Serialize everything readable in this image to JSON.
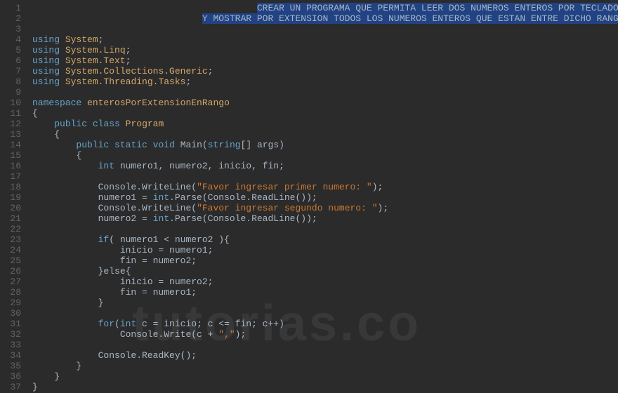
{
  "watermark": "tutorias.co",
  "comment": {
    "line1": "CREAR UN PROGRAMA QUE PERMITA LEER DOS NUMEROS ENTEROS POR TECLADO",
    "line2": "Y MOSTRAR POR EXTENSION TODOS LOS NUMEROS ENTEROS QUE ESTAN ENTRE DICHO RANGO"
  },
  "code": {
    "using": "using",
    "ns1": "System",
    "ns2": "System.Linq",
    "ns3": "System.Text",
    "ns4": "System.Collections.Generic",
    "ns5": "System.Threading.Tasks",
    "namespace_kw": "namespace",
    "namespace_name": "enterosPorExtensionEnRango",
    "public": "public",
    "class_kw": "class",
    "class_name": "Program",
    "static": "static",
    "void": "void",
    "main": "Main",
    "string_type": "string",
    "args": "[] args)",
    "int_kw": "int",
    "vars": " numero1, numero2, inicio, fin;",
    "console": "Console",
    "writeline": ".WriteLine(",
    "str1": "\"Favor ingresar primer numero: \"",
    "str2": "\"Favor ingresar segundo numero: \"",
    "n1_assign": "numero1 = ",
    "n2_assign": "numero2 = ",
    "parse": ".Parse(Console.ReadLine());",
    "if_kw": "if",
    "cond": "( numero1 < numero2 ){",
    "inicio1": "inicio = numero1;",
    "fin1": "fin = numero2;",
    "else_kw": "}else{",
    "inicio2": "inicio = numero2;",
    "fin2": "fin = numero1;",
    "for_kw": "for",
    "for_args1": " c = inicio; c <= fin; c++)",
    "write": "Console.Write(c + ",
    "str_comma": "\",\"",
    "readkey": "Console.ReadKey();"
  },
  "line_numbers": [
    "1",
    "2",
    "3",
    "4",
    "5",
    "6",
    "7",
    "8",
    "9",
    "10",
    "11",
    "12",
    "13",
    "14",
    "15",
    "16",
    "17",
    "18",
    "19",
    "20",
    "21",
    "22",
    "23",
    "24",
    "25",
    "26",
    "27",
    "28",
    "29",
    "30",
    "31",
    "32",
    "33",
    "34",
    "35",
    "36",
    "37"
  ]
}
